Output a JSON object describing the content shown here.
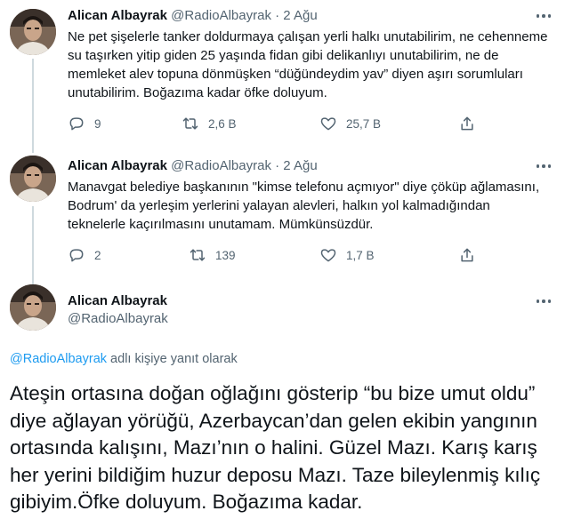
{
  "tweets": [
    {
      "name": "Alican Albayrak",
      "handle": "@RadioAlbayrak",
      "dot": "·",
      "date": "2 Ağu",
      "text": "Ne pet şişelerle tanker doldurmaya çalışan yerli halkı unutabilirim, ne cehenneme su taşırken yitip giden 25 yaşında fidan gibi delikanlıyı unutabilirim, ne de memleket alev topuna dönmüşken “düğündeydim yav” diyen aşırı sorumluları unutabilirim. Boğazıma kadar öfke doluyum.",
      "replies": "9",
      "retweets": "2,6 B",
      "likes": "25,7 B"
    },
    {
      "name": "Alican Albayrak",
      "handle": "@RadioAlbayrak",
      "dot": "·",
      "date": "2 Ağu",
      "text": "Manavgat belediye başkanının \"kimse telefonu açmıyor\" diye çöküp ağlamasını, Bodrum' da yerleşim yerlerini yalayan alevleri, halkın yol kalmadığından teknelerle kaçırılmasını unutamam. Mümkünsüzdür.",
      "replies": "2",
      "retweets": "139",
      "likes": "1,7 B"
    }
  ],
  "main": {
    "name": "Alican Albayrak",
    "handle": "@RadioAlbayrak",
    "reply_mention": "@RadioAlbayrak",
    "reply_suffix": " adlı kişiye yanıt olarak",
    "text": "Ateşin ortasına doğan oğlağını gösterip “bu bize umut oldu” diye ağlayan yörüğü, Azerbaycan’dan gelen ekibin yangının ortasında kalışını, Mazı’nın o halini. Güzel Mazı. Karış karış her yerini bildiğim huzur deposu Mazı. Taze bileylenmiş kılıç gibiyim.Öfke doluyum. Boğazıma kadar."
  },
  "icons": [
    "reply-icon",
    "retweet-icon",
    "like-icon",
    "share-icon",
    "more-icon"
  ],
  "colors": {
    "text": "#0f1419",
    "secondary": "#536471",
    "link": "#1d9bf0",
    "thread_line": "#cfd9de"
  }
}
